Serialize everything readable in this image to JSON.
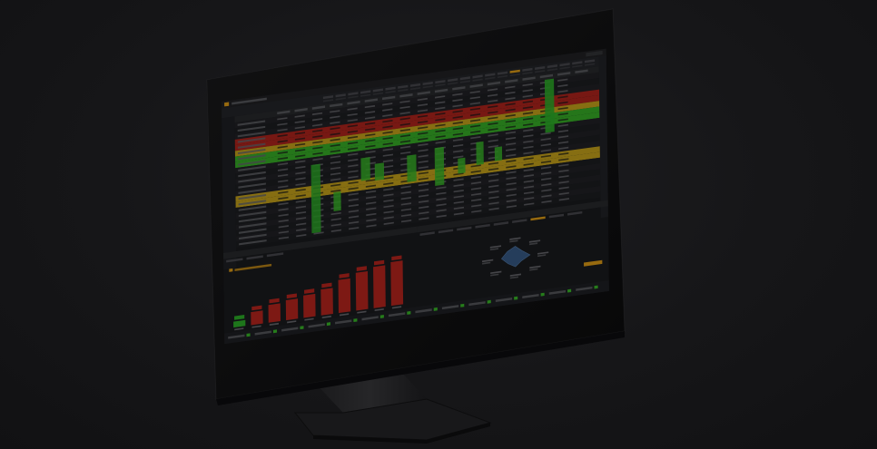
{
  "scene": {
    "background_color": "#161618",
    "monitor_bezel_color": "#0f0f10",
    "screen_base_color": "#1b1c1f"
  },
  "app": {
    "accent_orange": "#e8a317",
    "status_red": "#c0271f",
    "status_green": "#3bbf2a",
    "status_yellow": "#d8b21d",
    "panel_header_color": "#2a2b2f",
    "table_header_cells": 18,
    "chart_bars": [
      {
        "level": 0.1,
        "color": "#2fb52a"
      },
      {
        "level": 0.22,
        "color": "#c0271f"
      },
      {
        "level": 0.3,
        "color": "#c0271f"
      },
      {
        "level": 0.34,
        "color": "#c0271f"
      },
      {
        "level": 0.38,
        "color": "#c0271f"
      },
      {
        "level": 0.44,
        "color": "#c0271f"
      },
      {
        "level": 0.56,
        "color": "#c0271f"
      },
      {
        "level": 0.64,
        "color": "#c0271f"
      },
      {
        "level": 0.7,
        "color": "#c0271f"
      },
      {
        "level": 0.74,
        "color": "#c0271f"
      }
    ],
    "radar_color": "#3a5f8c"
  }
}
